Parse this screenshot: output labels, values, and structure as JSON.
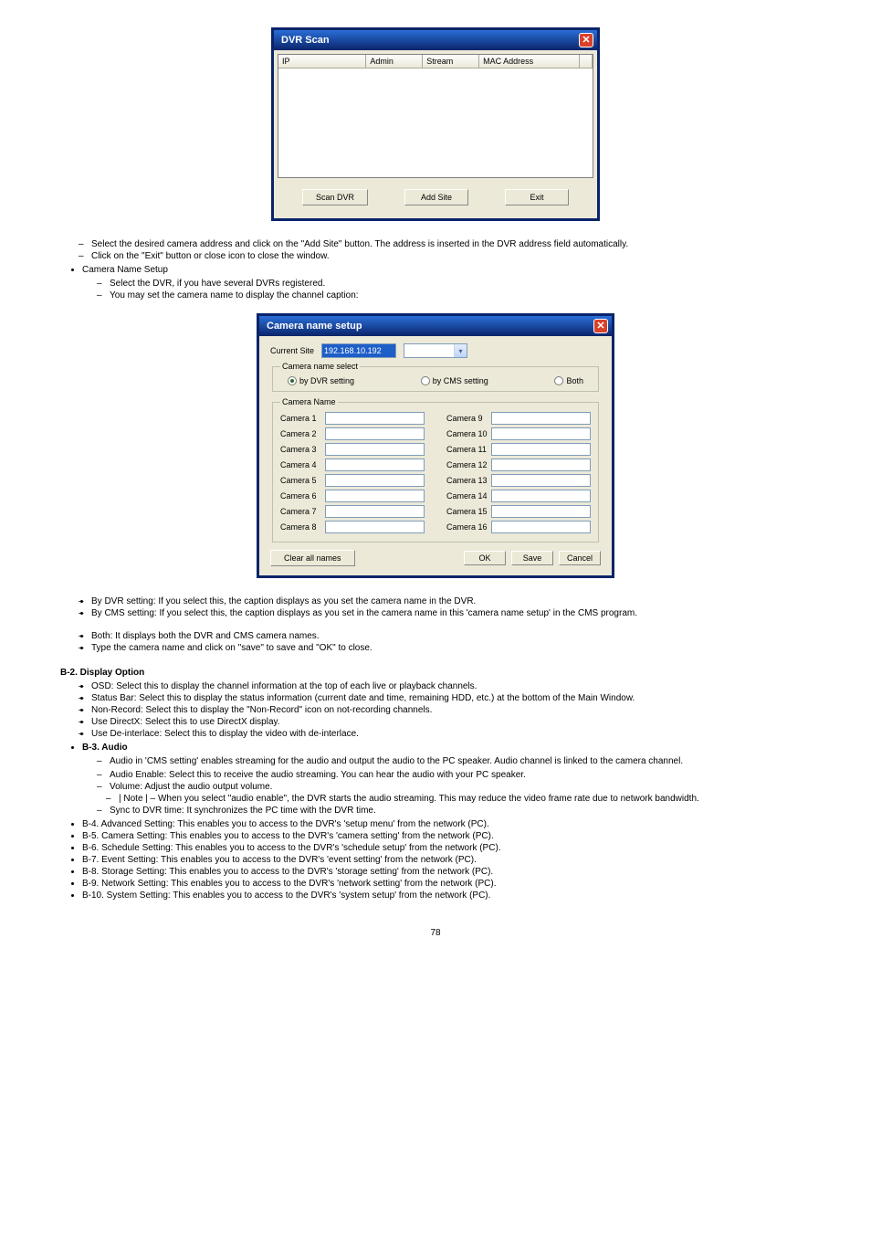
{
  "dvrscan": {
    "title": "DVR Scan",
    "columns": {
      "ip": "IP",
      "admin": "Admin",
      "stream": "Stream",
      "mac": "MAC Address"
    },
    "buttons": {
      "scan": "Scan DVR",
      "add": "Add Site",
      "exit": "Exit"
    }
  },
  "dvrscan_notes": [
    "Select the desired camera address and click on the \"Add Site\" button. The address is inserted in the DVR address field automatically.",
    "Click on the \"Exit\" button or close icon to close the window."
  ],
  "camsection": {
    "heading": "Camera Name Setup",
    "sub1": "Select the DVR, if you have several DVRs registered.",
    "sub2": "You may set the camera name to display the channel caption:"
  },
  "camsetup": {
    "title": "Camera name setup",
    "currentSiteLabel": "Current Site",
    "currentSiteValue": "192.168.10.192",
    "groupName": "Camera name select",
    "radios": {
      "dvr": "by DVR setting",
      "cms": "by CMS setting",
      "both": "Both"
    },
    "gridLabel": "Camera Name",
    "left": [
      "Camera 1",
      "Camera 2",
      "Camera 3",
      "Camera 4",
      "Camera 5",
      "Camera 6",
      "Camera 7",
      "Camera 8"
    ],
    "right": [
      "Camera 9",
      "Camera 10",
      "Camera 11",
      "Camera 12",
      "Camera 13",
      "Camera 14",
      "Camera 15",
      "Camera 16"
    ],
    "clear": "Clear all names",
    "ok": "OK",
    "save": "Save",
    "cancel": "Cancel"
  },
  "camnotes": [
    "By DVR setting: If you select this, the caption displays as you set the camera name in the DVR.",
    "By CMS setting: If you select this, the caption displays as you set in the camera name in this 'camera name setup' in the CMS program.",
    "Both: It displays both the DVR and CMS camera names.",
    "Type the camera name and click on \"save\" to save and \"OK\" to close."
  ],
  "b2": {
    "heading": "B-2. Display Option",
    "items": [
      "OSD: Select this to display the channel information at the top of each live or playback channels.",
      "Status Bar: Select this to display the status information (current date and time, remaining HDD, etc.) at the bottom of the Main Window.",
      "Non-Record: Select this to display the \"Non-Record\" icon on not-recording channels.",
      "Use DirectX: Select this to use DirectX display.",
      "Use De-interlace: Select this to display the video with de-interlace."
    ]
  },
  "b3": {
    "heading": "B-3. Audio",
    "intro": "Audio in 'CMS setting' enables streaming for the audio and output the audio to the PC speaker. Audio channel is linked to the camera channel.",
    "items": [
      "Audio Enable: Select this to receive the audio streaming. You can hear the audio with your PC speaker.",
      "Volume: Adjust the audio output volume.",
      "| Note | – When you select \"audio enable\", the DVR starts the audio streaming. This may reduce the video frame rate due to network bandwidth.",
      "Sync to DVR time: It synchronizes the PC time with the DVR time."
    ]
  },
  "b4b10": [
    "B-4. Advanced Setting: This enables you to access to the DVR's 'setup menu' from the network (PC).",
    "B-5. Camera Setting: This enables you to access to the DVR's 'camera setting' from the network (PC).",
    "B-6. Schedule Setting: This enables you to access to the DVR's 'schedule setup' from the network (PC).",
    "B-7. Event Setting: This enables you to access to the DVR's 'event setting' from the network (PC).",
    "B-8. Storage Setting: This enables you to access to the DVR's 'storage setting' from the network (PC).",
    "B-9. Network Setting: This enables you to access to the DVR's 'network setting' from the network (PC).",
    "B-10. System Setting: This enables you to access to the DVR's 'system setup' from the network (PC)."
  ],
  "pageno": "78"
}
